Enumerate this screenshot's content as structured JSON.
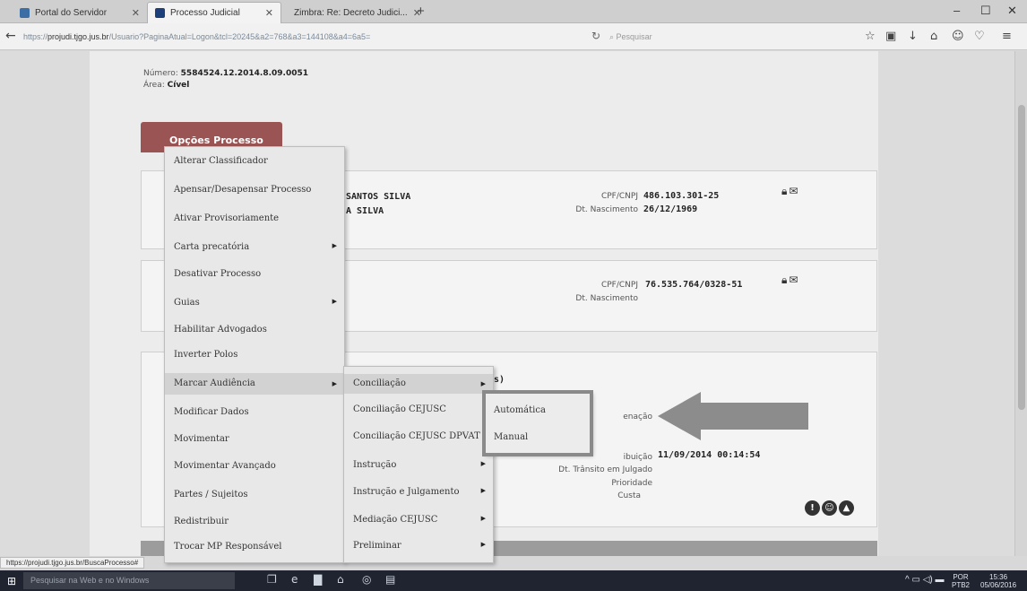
{
  "browser": {
    "tabs": [
      {
        "label": "Portal do Servidor",
        "active": false
      },
      {
        "label": "Processo Judicial",
        "active": true
      },
      {
        "label": "Zimbra: Re: Decreto Judici...",
        "active": false
      }
    ],
    "new_tab": "+",
    "url_prefix": "https://",
    "url_host": "projudi.tjgo.jus.br",
    "url_rest": "/Usuario?PaginaAtual=Logon&tcl=20245&a2=768&a3=144108&a4=6a5=",
    "search_placeholder": "Pesquisar",
    "window_controls": [
      "–",
      "☐",
      "✕"
    ]
  },
  "process": {
    "numero_label": "Número:",
    "numero_value": "5584524.12.2014.8.09.0051",
    "area_label": "Área:",
    "area_value": "Cível"
  },
  "opcoes_button": "Opções Processo",
  "parties": {
    "p1": {
      "name_line1": "SANTOS SILVA",
      "name_line2": "A SILVA",
      "cpf_label": "CPF/CNPJ",
      "cpf_value": "486.103.301-25",
      "nasc_label": "Dt. Nascimento",
      "nasc_value": "26/12/1969"
    },
    "p2": {
      "cpf_label": "CPF/CNPJ",
      "cpf_value": "76.535.764/0328-51",
      "nasc_label": "Dt. Nascimento"
    },
    "p3": {
      "header_fragment": "s)",
      "lbl_nacao": "enação",
      "lbl_distrib": "ibuição",
      "distrib_value": "11/09/2014 00:14:54",
      "lbl_transito": "Dt. Trânsito em Julgado",
      "lbl_prioridade": "Prioridade",
      "lbl_custa": "Custa"
    }
  },
  "menu_main": [
    {
      "label": "Alterar Classificador",
      "sub": false
    },
    {
      "label": "Apensar/Desapensar Processo",
      "sub": false
    },
    {
      "label": "Ativar Provisoriamente",
      "sub": false
    },
    {
      "label": "Carta precatória",
      "sub": true
    },
    {
      "label": "Desativar Processo",
      "sub": false
    },
    {
      "label": "Guias",
      "sub": true
    },
    {
      "label": "Habilitar Advogados",
      "sub": false
    },
    {
      "label": "Inverter Polos",
      "sub": false
    },
    {
      "label": "Marcar Audiência",
      "sub": true
    },
    {
      "label": "Modificar Dados",
      "sub": false
    },
    {
      "label": "Movimentar",
      "sub": false
    },
    {
      "label": "Movimentar Avançado",
      "sub": false
    },
    {
      "label": "Partes / Sujeitos",
      "sub": false
    },
    {
      "label": "Redistribuir",
      "sub": false
    },
    {
      "label": "Trocar MP Responsável",
      "sub": false
    }
  ],
  "menu_audiencia": [
    {
      "label": "Conciliação",
      "sub": true
    },
    {
      "label": "Conciliação CEJUSC",
      "sub": false
    },
    {
      "label": "Conciliação CEJUSC DPVAT",
      "sub": false
    },
    {
      "label": "Instrução",
      "sub": true
    },
    {
      "label": "Instrução e Julgamento",
      "sub": true
    },
    {
      "label": "Mediação CEJUSC",
      "sub": true
    },
    {
      "label": "Preliminar",
      "sub": true
    }
  ],
  "menu_cejusc": [
    {
      "label": "Automática"
    },
    {
      "label": "Manual"
    }
  ],
  "status_link": "https://projudi.tjgo.jus.br/BuscaProcesso#",
  "taskbar": {
    "search_placeholder": "Pesquisar na Web e no Windows",
    "lang_line1": "POR",
    "lang_line2": "PTB2",
    "time": "15:36",
    "date": "05/06/2016"
  },
  "colors": {
    "opcoes_button": "#9a5454",
    "menu_highlight": "#d2d2d2",
    "callout_arrow": "#8c8c8c"
  }
}
